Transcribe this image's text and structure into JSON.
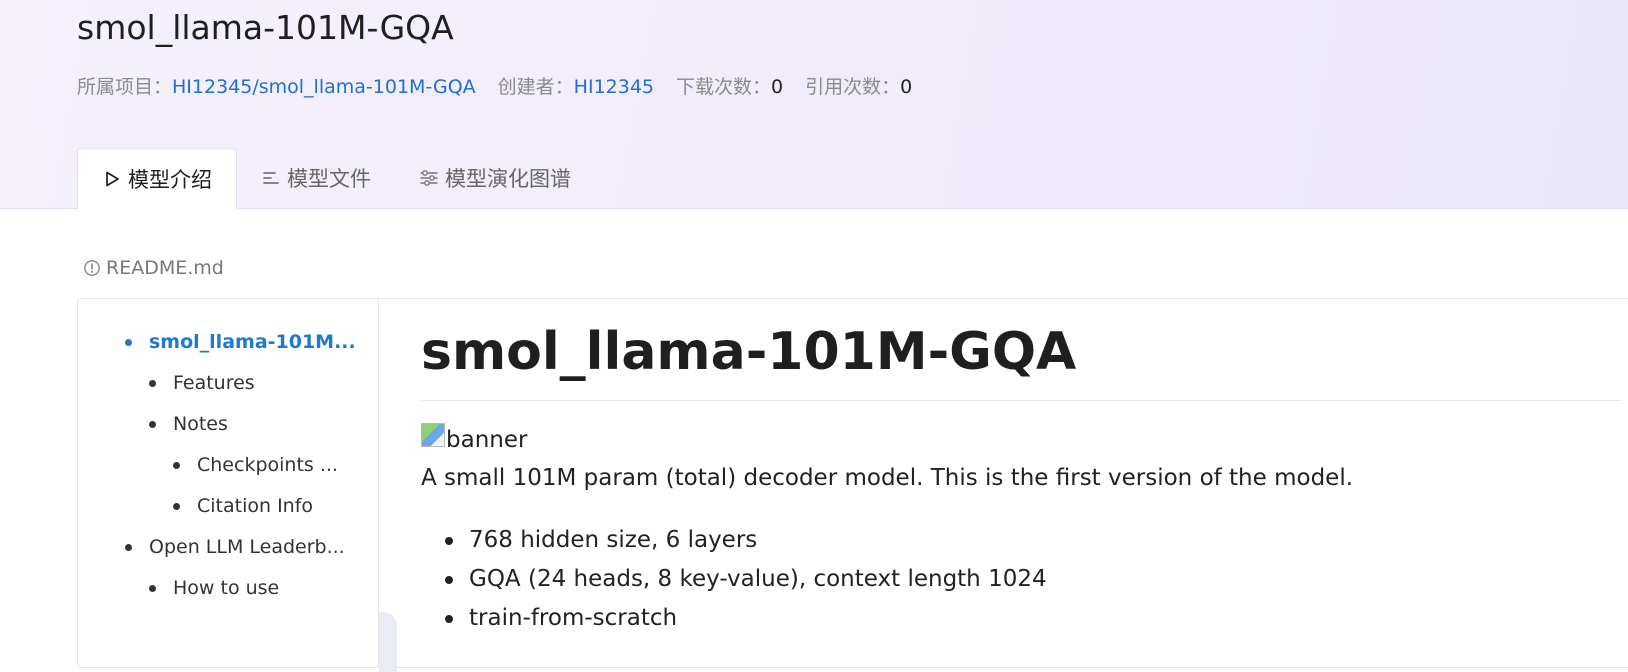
{
  "header": {
    "title": "smol_llama-101M-GQA",
    "meta": {
      "project_label": "所属项目：",
      "project_value": "HI12345/smol_llama-101M-GQA",
      "creator_label": "创建者：",
      "creator_value": "HI12345",
      "downloads_label": "下载次数：",
      "downloads_value": "0",
      "citations_label": "引用次数：",
      "citations_value": "0"
    },
    "tabs": [
      {
        "label": "模型介绍",
        "icon": "play-triangle-icon",
        "active": true
      },
      {
        "label": "模型文件",
        "icon": "file-lines-icon",
        "active": false
      },
      {
        "label": "模型演化图谱",
        "icon": "sliders-icon",
        "active": false
      }
    ]
  },
  "readme": {
    "label": "README.md",
    "icon": "info-circle-icon"
  },
  "toc": {
    "items": [
      {
        "label": "smol_llama-101M...",
        "level": 0,
        "active": true
      },
      {
        "label": "Features",
        "level": 1,
        "active": false
      },
      {
        "label": "Notes",
        "level": 1,
        "active": false
      },
      {
        "label": "Checkpoints ...",
        "level": 2,
        "active": false
      },
      {
        "label": "Citation Info",
        "level": 2,
        "active": false
      },
      {
        "label": "Open LLM Leaderb...",
        "level": 0,
        "active": false
      },
      {
        "label": "How to use",
        "level": 1,
        "active": false
      }
    ]
  },
  "main": {
    "heading": "smol_llama-101M-GQA",
    "banner_alt": "banner",
    "intro": "A small 101M param (total) decoder model. This is the first version of the model.",
    "features": [
      "768 hidden size, 6 layers",
      "GQA (24 heads, 8 key-value), context length 1024",
      "train-from-scratch"
    ]
  },
  "colors": {
    "link": "#1f6fd1",
    "toc_active": "#1f78d1",
    "header_bg": "#f3effb"
  }
}
